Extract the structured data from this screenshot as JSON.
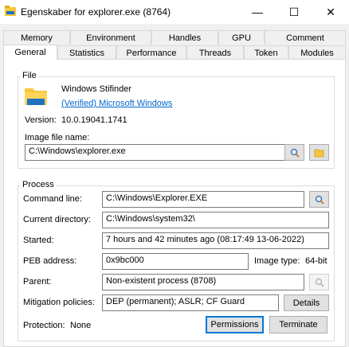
{
  "window": {
    "title": "Egenskaber for explorer.exe (8764)",
    "minimize_glyph": "—",
    "maximize_glyph": "☐",
    "close_glyph": "✕"
  },
  "tabs_row1": [
    "Memory",
    "Environment",
    "Handles",
    "GPU",
    "Comment"
  ],
  "tabs_row2": [
    "General",
    "Statistics",
    "Performance",
    "Threads",
    "Token",
    "Modules"
  ],
  "active_tab": "General",
  "file": {
    "group_label": "File",
    "description": "Windows Stifinder",
    "company": "(Verified) Microsoft Windows",
    "version_label": "Version:",
    "version_value": "10.0.19041.1741",
    "image_file_label": "Image file name:",
    "image_file_value": "C:\\Windows\\explorer.exe"
  },
  "process": {
    "group_label": "Process",
    "command_line_label": "Command line:",
    "command_line_value": "C:\\Windows\\Explorer.EXE",
    "current_dir_label": "Current directory:",
    "current_dir_value": "C:\\Windows\\system32\\",
    "started_label": "Started:",
    "started_value": "7 hours and 42 minutes ago (08:17:49 13-06-2022)",
    "peb_label": "PEB address:",
    "peb_value": "0x9bc000",
    "image_type_label": "Image type:",
    "image_type_value": "64-bit",
    "parent_label": "Parent:",
    "parent_value": "Non-existent process (8708)",
    "mitigation_label": "Mitigation policies:",
    "mitigation_value": "DEP (permanent); ASLR; CF Guard",
    "details_button": "Details",
    "protection_label": "Protection:",
    "protection_value": "None",
    "permissions_button": "Permissions",
    "terminate_button": "Terminate"
  },
  "colors": {
    "folder_yellow": "#f8c63d",
    "folder_blue": "#1e73be",
    "link_blue": "#0066cc",
    "focus_blue": "#0078d7"
  },
  "icons": [
    "app-icon",
    "explorer-folder-icon",
    "search-icon",
    "folder-open-icon"
  ]
}
